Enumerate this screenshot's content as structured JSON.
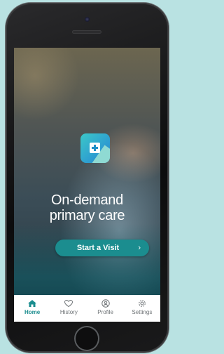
{
  "hero": {
    "headline_line1": "On-demand",
    "headline_line2": "primary care",
    "cta_label": "Start a Visit",
    "cta_chevron": "›"
  },
  "tabbar": {
    "tabs": [
      {
        "label": "Home",
        "icon": "home-icon",
        "active": true
      },
      {
        "label": "History",
        "icon": "heart-icon",
        "active": false
      },
      {
        "label": "Profile",
        "icon": "profile-icon",
        "active": false
      },
      {
        "label": "Settings",
        "icon": "gear-icon",
        "active": false
      }
    ]
  },
  "colors": {
    "accent": "#1b8d8f",
    "background": "#b9e2e2",
    "tab_inactive": "#6d7275"
  }
}
